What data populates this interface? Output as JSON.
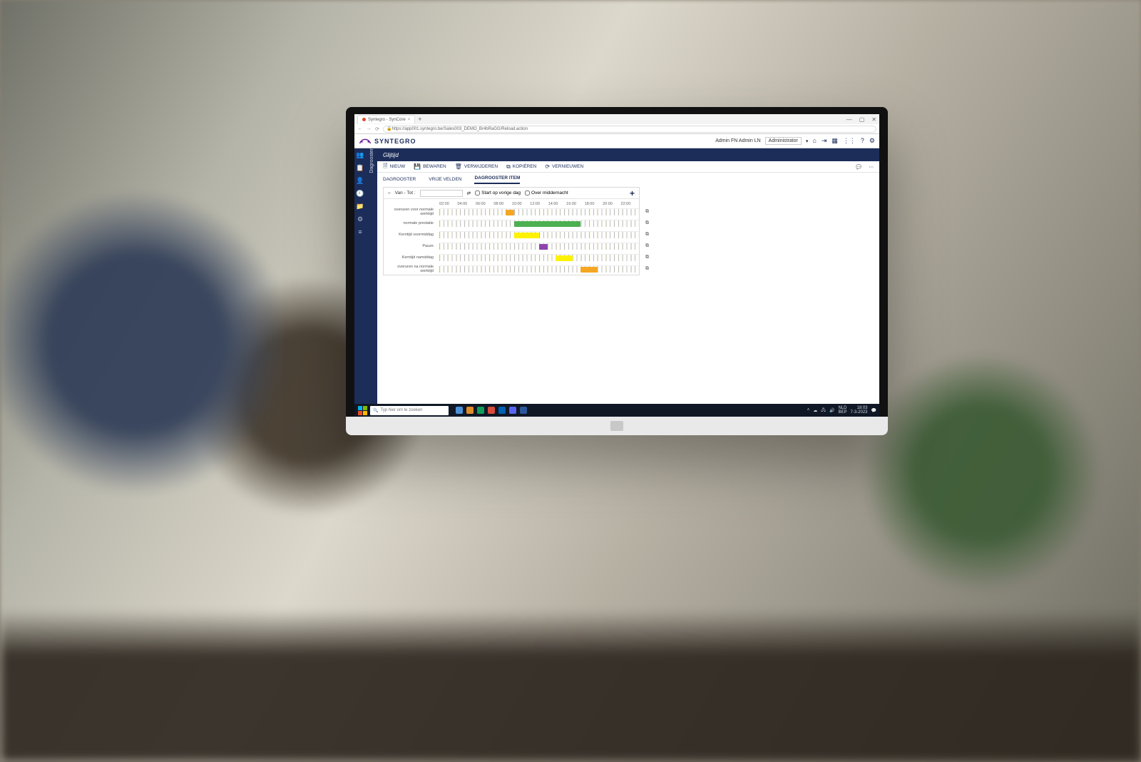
{
  "browser": {
    "tab_title": "Syntegro - SynCore",
    "url": "https://app001.syntegro.be/Sales003_DEMO_Br4bRaGG/Reload.action"
  },
  "app": {
    "brand": "SYNTEGRO",
    "user_name": "Admin FN Admin LN",
    "role": "Administrator"
  },
  "side_label": "Dagrooster",
  "page_title": "Glijtijd",
  "toolbar": {
    "nieuw": "NIEUW",
    "bewaren": "BEWAREN",
    "verwijderen": "VERWIJDEREN",
    "kopieren": "KOPIËREN",
    "vernieuwen": "VERNIEUWEN"
  },
  "tabs": {
    "dagrooster": "DAGROOSTER",
    "vrije_velden": "VRIJE VELDEN",
    "dagrooster_item": "DAGROOSTER ITEM"
  },
  "schedule": {
    "van_tot_label": "Van - Tot :",
    "start_vorige": "Start op vorige dag",
    "over_middernacht": "Over middernacht",
    "hours": [
      "02:00",
      "04:00",
      "06:00",
      "08:00",
      "10:00",
      "12:00",
      "14:00",
      "16:00",
      "18:00",
      "20:00",
      "22:00"
    ],
    "rows": [
      {
        "label": "overuren voor normale werktijd",
        "color": "orange",
        "start": 8,
        "end": 9
      },
      {
        "label": "normale prestatie",
        "color": "green",
        "start": 9,
        "end": 17
      },
      {
        "label": "Kerntijd voormiddag",
        "color": "yellow",
        "start": 9,
        "end": 12
      },
      {
        "label": "Pauze",
        "color": "purple",
        "start": 12,
        "end": 13
      },
      {
        "label": "Kerntijd namiddag",
        "color": "yellow",
        "start": 14,
        "end": 16
      },
      {
        "label": "overuren na normale werktijd",
        "color": "orange",
        "start": 17,
        "end": 19
      }
    ]
  },
  "taskbar": {
    "search_placeholder": "Typ hier om te zoeken",
    "lang": "NLD",
    "kb": "BEP",
    "time": "18:03",
    "date": "7-3-2023"
  }
}
